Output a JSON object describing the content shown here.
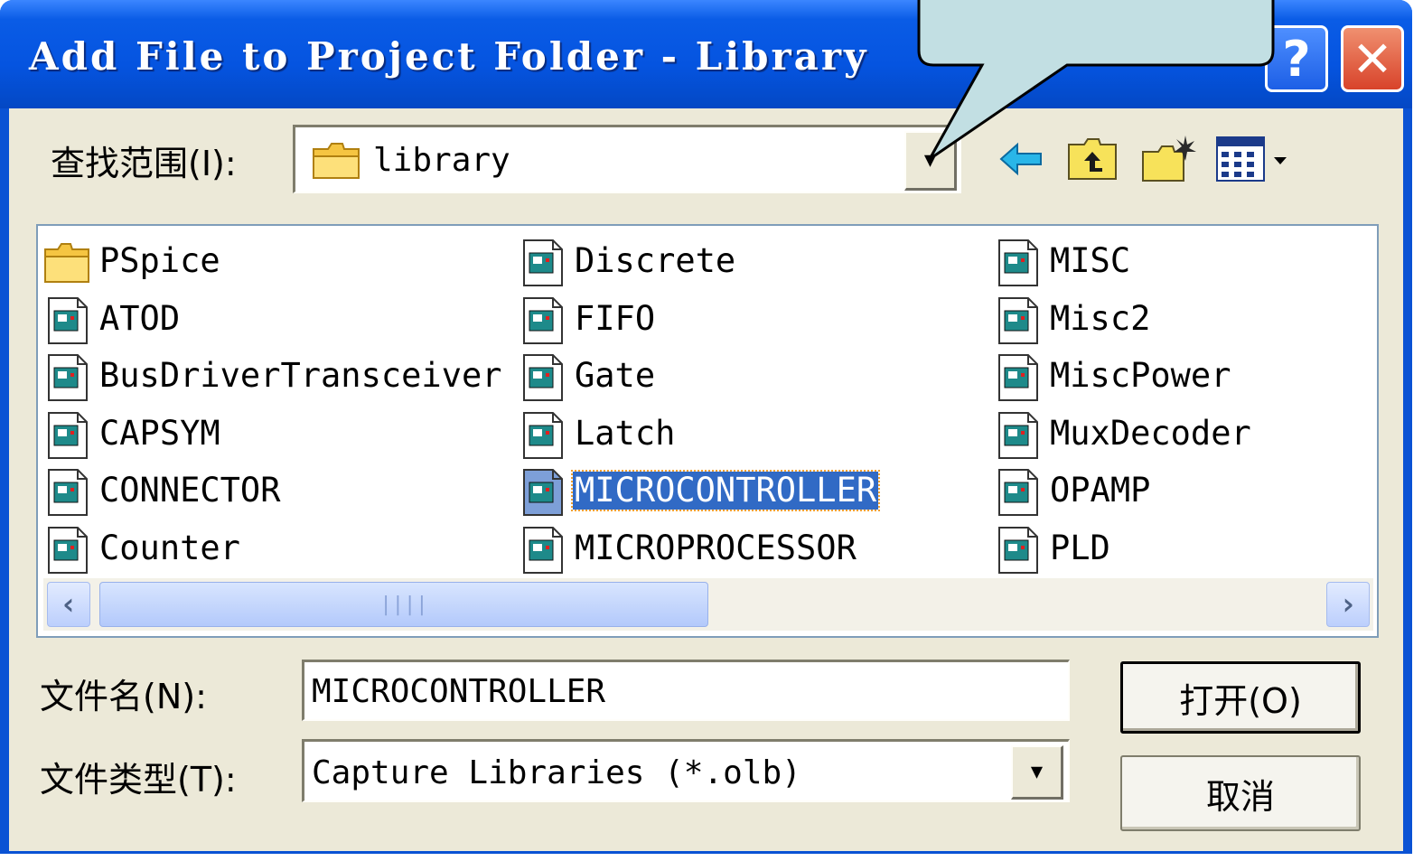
{
  "dialog": {
    "title": "Add File to Project Folder - Library",
    "help_label": "?",
    "close_label": "✕"
  },
  "lookin": {
    "label": "查找范围(I):",
    "value": "library"
  },
  "toolbar": {
    "icons": [
      "back-arrow-icon",
      "up-folder-icon",
      "new-folder-icon",
      "view-menu-icon"
    ]
  },
  "files": {
    "columns": [
      [
        {
          "name": "PSpice",
          "icon": "folder-icon"
        },
        {
          "name": "ATOD",
          "icon": "library-file-icon"
        },
        {
          "name": "BusDriverTransceiver",
          "icon": "library-file-icon"
        },
        {
          "name": "CAPSYM",
          "icon": "library-file-icon"
        },
        {
          "name": "CONNECTOR",
          "icon": "library-file-icon"
        },
        {
          "name": "Counter",
          "icon": "library-file-icon"
        }
      ],
      [
        {
          "name": "Discrete",
          "icon": "library-file-icon"
        },
        {
          "name": "FIFO",
          "icon": "library-file-icon"
        },
        {
          "name": "Gate",
          "icon": "library-file-icon"
        },
        {
          "name": "Latch",
          "icon": "library-file-icon"
        },
        {
          "name": "MICROCONTROLLER",
          "icon": "library-file-icon",
          "selected": true
        },
        {
          "name": "MICROPROCESSOR",
          "icon": "library-file-icon"
        }
      ],
      [
        {
          "name": "MISC",
          "icon": "library-file-icon"
        },
        {
          "name": "Misc2",
          "icon": "library-file-icon"
        },
        {
          "name": "MiscPower",
          "icon": "library-file-icon"
        },
        {
          "name": "MuxDecoder",
          "icon": "library-file-icon"
        },
        {
          "name": "OPAMP",
          "icon": "library-file-icon"
        },
        {
          "name": "PLD",
          "icon": "library-file-icon"
        }
      ]
    ]
  },
  "filename": {
    "label": "文件名(N):",
    "value": "MICROCONTROLLER"
  },
  "filetype": {
    "label": "文件类型(T):",
    "value": "Capture Libraries (*.olb)"
  },
  "buttons": {
    "open": "打开(O)",
    "cancel": "取消"
  },
  "colors": {
    "title_bar": "#0554e0",
    "selection": "#316ac5",
    "callout_fill": "#c2dfe3",
    "dialog_face": "#ece9d8"
  }
}
